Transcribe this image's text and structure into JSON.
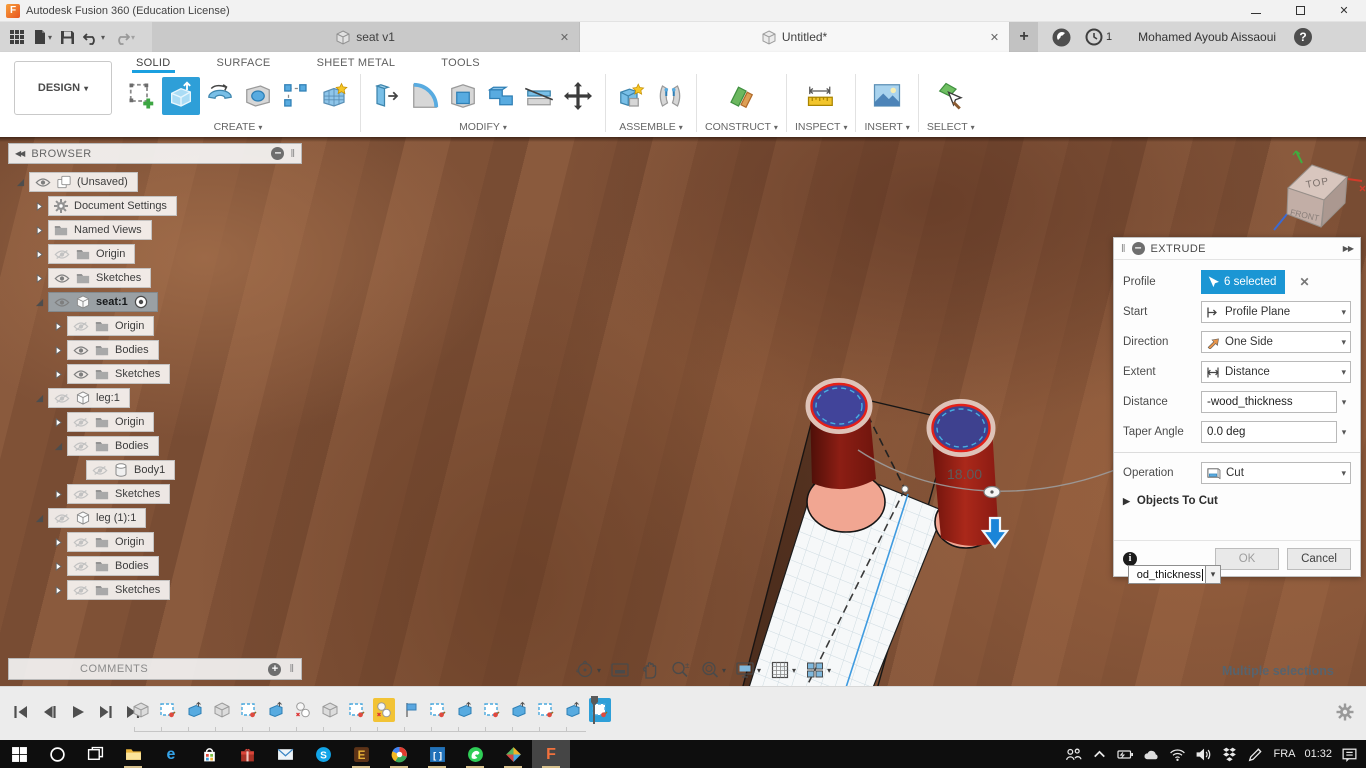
{
  "glyphs": {
    "caret": "▾",
    "close": "✕",
    "plus": "+",
    "minus": "–",
    "collapse_double": "◀◀",
    "expand_double": "▶▶",
    "tri_right": "▶",
    "grip": "‖",
    "help": "?"
  },
  "title_bar": {
    "title": "Autodesk Fusion 360 (Education License)",
    "logo_letter": "F"
  },
  "tabs": {
    "doc_tabs": [
      {
        "label": "seat v1"
      },
      {
        "label": "Untitled*"
      }
    ],
    "job_badge": "1",
    "user": "Mohamed Ayoub Aissaoui"
  },
  "ribbon": {
    "design": "DESIGN",
    "tabs": [
      {
        "label": "SOLID",
        "active": true
      },
      {
        "label": "SURFACE"
      },
      {
        "label": "SHEET METAL"
      },
      {
        "label": "TOOLS"
      }
    ],
    "groups": [
      {
        "label": "CREATE"
      },
      {
        "label": "MODIFY"
      },
      {
        "label": "ASSEMBLE"
      },
      {
        "label": "CONSTRUCT"
      },
      {
        "label": "INSPECT"
      },
      {
        "label": "INSERT"
      },
      {
        "label": "SELECT"
      }
    ]
  },
  "browser": {
    "title": "BROWSER",
    "items": [
      {
        "label": "(Unsaved)",
        "level": 0,
        "expand": "exp",
        "eye": "on",
        "icon": "doc"
      },
      {
        "label": "Document Settings",
        "level": 1,
        "expand": "col",
        "eye": null,
        "icon": "gear"
      },
      {
        "label": "Named Views",
        "level": 1,
        "expand": "col",
        "eye": null,
        "icon": "folder"
      },
      {
        "label": "Origin",
        "level": 1,
        "expand": "col",
        "eye": "off",
        "icon": "folder"
      },
      {
        "label": "Sketches",
        "level": 1,
        "expand": "col",
        "eye": "on",
        "icon": "folder"
      },
      {
        "label": "seat:1",
        "level": 1,
        "expand": "exp",
        "eye": "on",
        "icon": "cube",
        "selected": true,
        "radio": true
      },
      {
        "label": "Origin",
        "level": 2,
        "expand": "col",
        "eye": "off",
        "icon": "folder"
      },
      {
        "label": "Bodies",
        "level": 2,
        "expand": "col",
        "eye": "on",
        "icon": "folder"
      },
      {
        "label": "Sketches",
        "level": 2,
        "expand": "col",
        "eye": "on",
        "icon": "folder"
      },
      {
        "label": "leg:1",
        "level": 1,
        "expand": "exp",
        "eye": "off",
        "icon": "cube"
      },
      {
        "label": "Origin",
        "level": 2,
        "expand": "col",
        "eye": "off",
        "icon": "folder"
      },
      {
        "label": "Bodies",
        "level": 2,
        "expand": "exp",
        "eye": "off",
        "icon": "folder"
      },
      {
        "label": "Body1",
        "level": 3,
        "expand": null,
        "eye": "off",
        "icon": "body"
      },
      {
        "label": "Sketches",
        "level": 2,
        "expand": "col",
        "eye": "off",
        "icon": "folder"
      },
      {
        "label": "leg (1):1",
        "level": 1,
        "expand": "exp",
        "eye": "off",
        "icon": "cube"
      },
      {
        "label": "Origin",
        "level": 2,
        "expand": "col",
        "eye": "off",
        "icon": "folder"
      },
      {
        "label": "Bodies",
        "level": 2,
        "expand": "col",
        "eye": "off",
        "icon": "folder"
      },
      {
        "label": "Sketches",
        "level": 2,
        "expand": "col",
        "eye": "off",
        "icon": "folder"
      }
    ]
  },
  "viewcube": {
    "top": "TOP",
    "front": "FRONT"
  },
  "model": {
    "dim_label": "18.00"
  },
  "extrude": {
    "title": "EXTRUDE",
    "profile_label": "Profile",
    "profile_value": "6 selected",
    "start_label": "Start",
    "start_value": "Profile Plane",
    "direction_label": "Direction",
    "direction_value": "One Side",
    "extent_label": "Extent",
    "extent_value": "Distance",
    "distance_label": "Distance",
    "distance_value": "-wood_thickness",
    "taper_label": "Taper Angle",
    "taper_value": "0.0 deg",
    "operation_label": "Operation",
    "operation_value": "Cut",
    "objects_label": "Objects To Cut",
    "info": "i",
    "ok_label": "OK",
    "cancel_label": "Cancel"
  },
  "floating_input": {
    "value": "od_thickness"
  },
  "comments": {
    "title": "COMMENTS"
  },
  "status": {
    "selection": "Multiple selections"
  },
  "timeline": {
    "items": [
      {
        "type": "component"
      },
      {
        "type": "sketch"
      },
      {
        "type": "extrude"
      },
      {
        "type": "component"
      },
      {
        "type": "sketch"
      },
      {
        "type": "extrude"
      },
      {
        "type": "copy"
      },
      {
        "type": "component"
      },
      {
        "type": "sketch"
      },
      {
        "type": "copy",
        "state": "yellow"
      },
      {
        "type": "flag"
      },
      {
        "type": "sketch"
      },
      {
        "type": "extrude"
      },
      {
        "type": "sketch"
      },
      {
        "type": "extrude"
      },
      {
        "type": "sketch"
      },
      {
        "type": "extrude"
      },
      {
        "type": "sketch",
        "state": "blue"
      }
    ]
  },
  "taskbar": {
    "lang": "FRA",
    "time": "01:32",
    "apps": [
      {
        "name": "start"
      },
      {
        "name": "cortana"
      },
      {
        "name": "task-view"
      },
      {
        "name": "file-explorer",
        "running": true
      },
      {
        "name": "edge"
      },
      {
        "name": "store"
      },
      {
        "name": "gift"
      },
      {
        "name": "mail"
      },
      {
        "name": "skype"
      },
      {
        "name": "e-app",
        "running": true
      },
      {
        "name": "chrome",
        "running": true
      },
      {
        "name": "brackets",
        "running": true
      },
      {
        "name": "whatsapp",
        "running": true
      },
      {
        "name": "design-app",
        "running": true
      },
      {
        "name": "fusion-360",
        "running": true,
        "active": true
      }
    ]
  }
}
